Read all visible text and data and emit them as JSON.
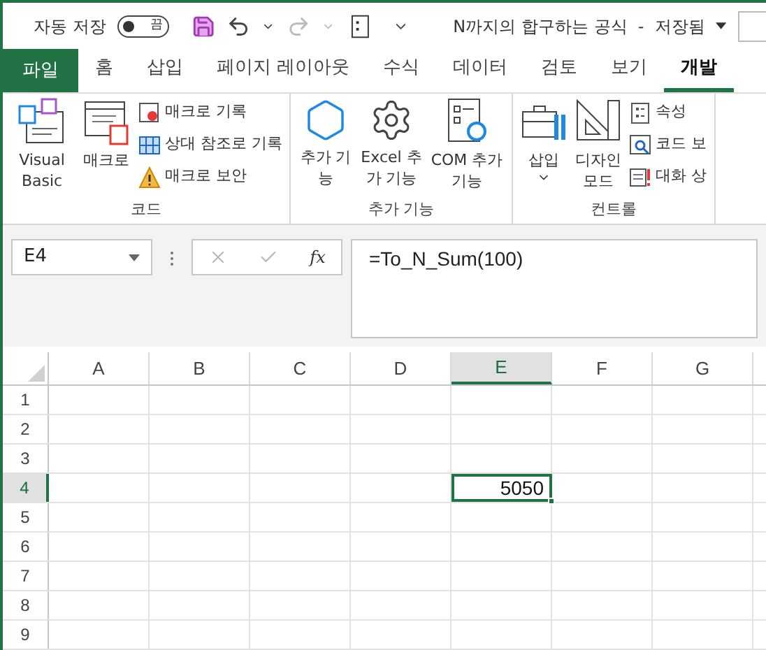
{
  "title_bar": {
    "autosave": {
      "label": "자동 저장",
      "on": false,
      "state_text": "끔"
    },
    "document_title": "N까지의 합구하는 공식  -  저장됨"
  },
  "tabs": [
    {
      "label": "파일",
      "kind": "file",
      "selected": false
    },
    {
      "label": "홈",
      "kind": "tab",
      "selected": false
    },
    {
      "label": "삽입",
      "kind": "tab",
      "selected": false
    },
    {
      "label": "페이지 레이아웃",
      "kind": "tab",
      "selected": false
    },
    {
      "label": "수식",
      "kind": "tab",
      "selected": false
    },
    {
      "label": "데이터",
      "kind": "tab",
      "selected": false
    },
    {
      "label": "검토",
      "kind": "tab",
      "selected": false
    },
    {
      "label": "보기",
      "kind": "tab",
      "selected": false
    },
    {
      "label": "개발",
      "kind": "tab",
      "selected": true
    }
  ],
  "ribbon_groups": [
    {
      "title": "코드",
      "items": [
        {
          "kind": "large",
          "label": "Visual Basic"
        },
        {
          "kind": "large",
          "label": "매크로"
        },
        {
          "kind": "small_stack",
          "items": [
            {
              "label": "매크로 기록"
            },
            {
              "label": "상대 참조로 기록"
            },
            {
              "label": "매크로 보안"
            }
          ]
        }
      ]
    },
    {
      "title": "추가 기능",
      "items": [
        {
          "kind": "large",
          "label": "추가 기능"
        },
        {
          "kind": "large",
          "label": "Excel 추가 기능"
        },
        {
          "kind": "large",
          "label": "COM 추가 기능"
        }
      ]
    },
    {
      "title": "컨트롤",
      "items": [
        {
          "kind": "large",
          "label": "삽입",
          "dropdown": true
        },
        {
          "kind": "large",
          "label": "디자인 모드"
        },
        {
          "kind": "small_stack",
          "items": [
            {
              "label": "속성"
            },
            {
              "label": "코드 보"
            },
            {
              "label": "대화 상"
            }
          ]
        }
      ]
    }
  ],
  "formula_bar": {
    "name_box": "E4",
    "function_label": "fx",
    "formula": "=To_N_Sum(100)"
  },
  "grid": {
    "columns": [
      {
        "label": "A",
        "selected": false
      },
      {
        "label": "B",
        "selected": false
      },
      {
        "label": "C",
        "selected": false
      },
      {
        "label": "D",
        "selected": false
      },
      {
        "label": "E",
        "selected": true
      },
      {
        "label": "F",
        "selected": false
      },
      {
        "label": "G",
        "selected": false
      }
    ],
    "rows": [
      {
        "label": "1",
        "selected": false
      },
      {
        "label": "2",
        "selected": false
      },
      {
        "label": "3",
        "selected": false
      },
      {
        "label": "4",
        "selected": true,
        "cells": [
          {
            "selected": false
          },
          {
            "selected": false
          },
          {
            "selected": false
          },
          {
            "selected": false
          },
          {
            "value": "5050",
            "selected": true
          },
          {
            "selected": false
          },
          {
            "selected": false
          }
        ]
      },
      {
        "label": "5",
        "selected": false
      },
      {
        "label": "6",
        "selected": false
      },
      {
        "label": "7",
        "selected": false
      },
      {
        "label": "8",
        "selected": false
      },
      {
        "label": "9",
        "selected": false
      }
    ]
  }
}
